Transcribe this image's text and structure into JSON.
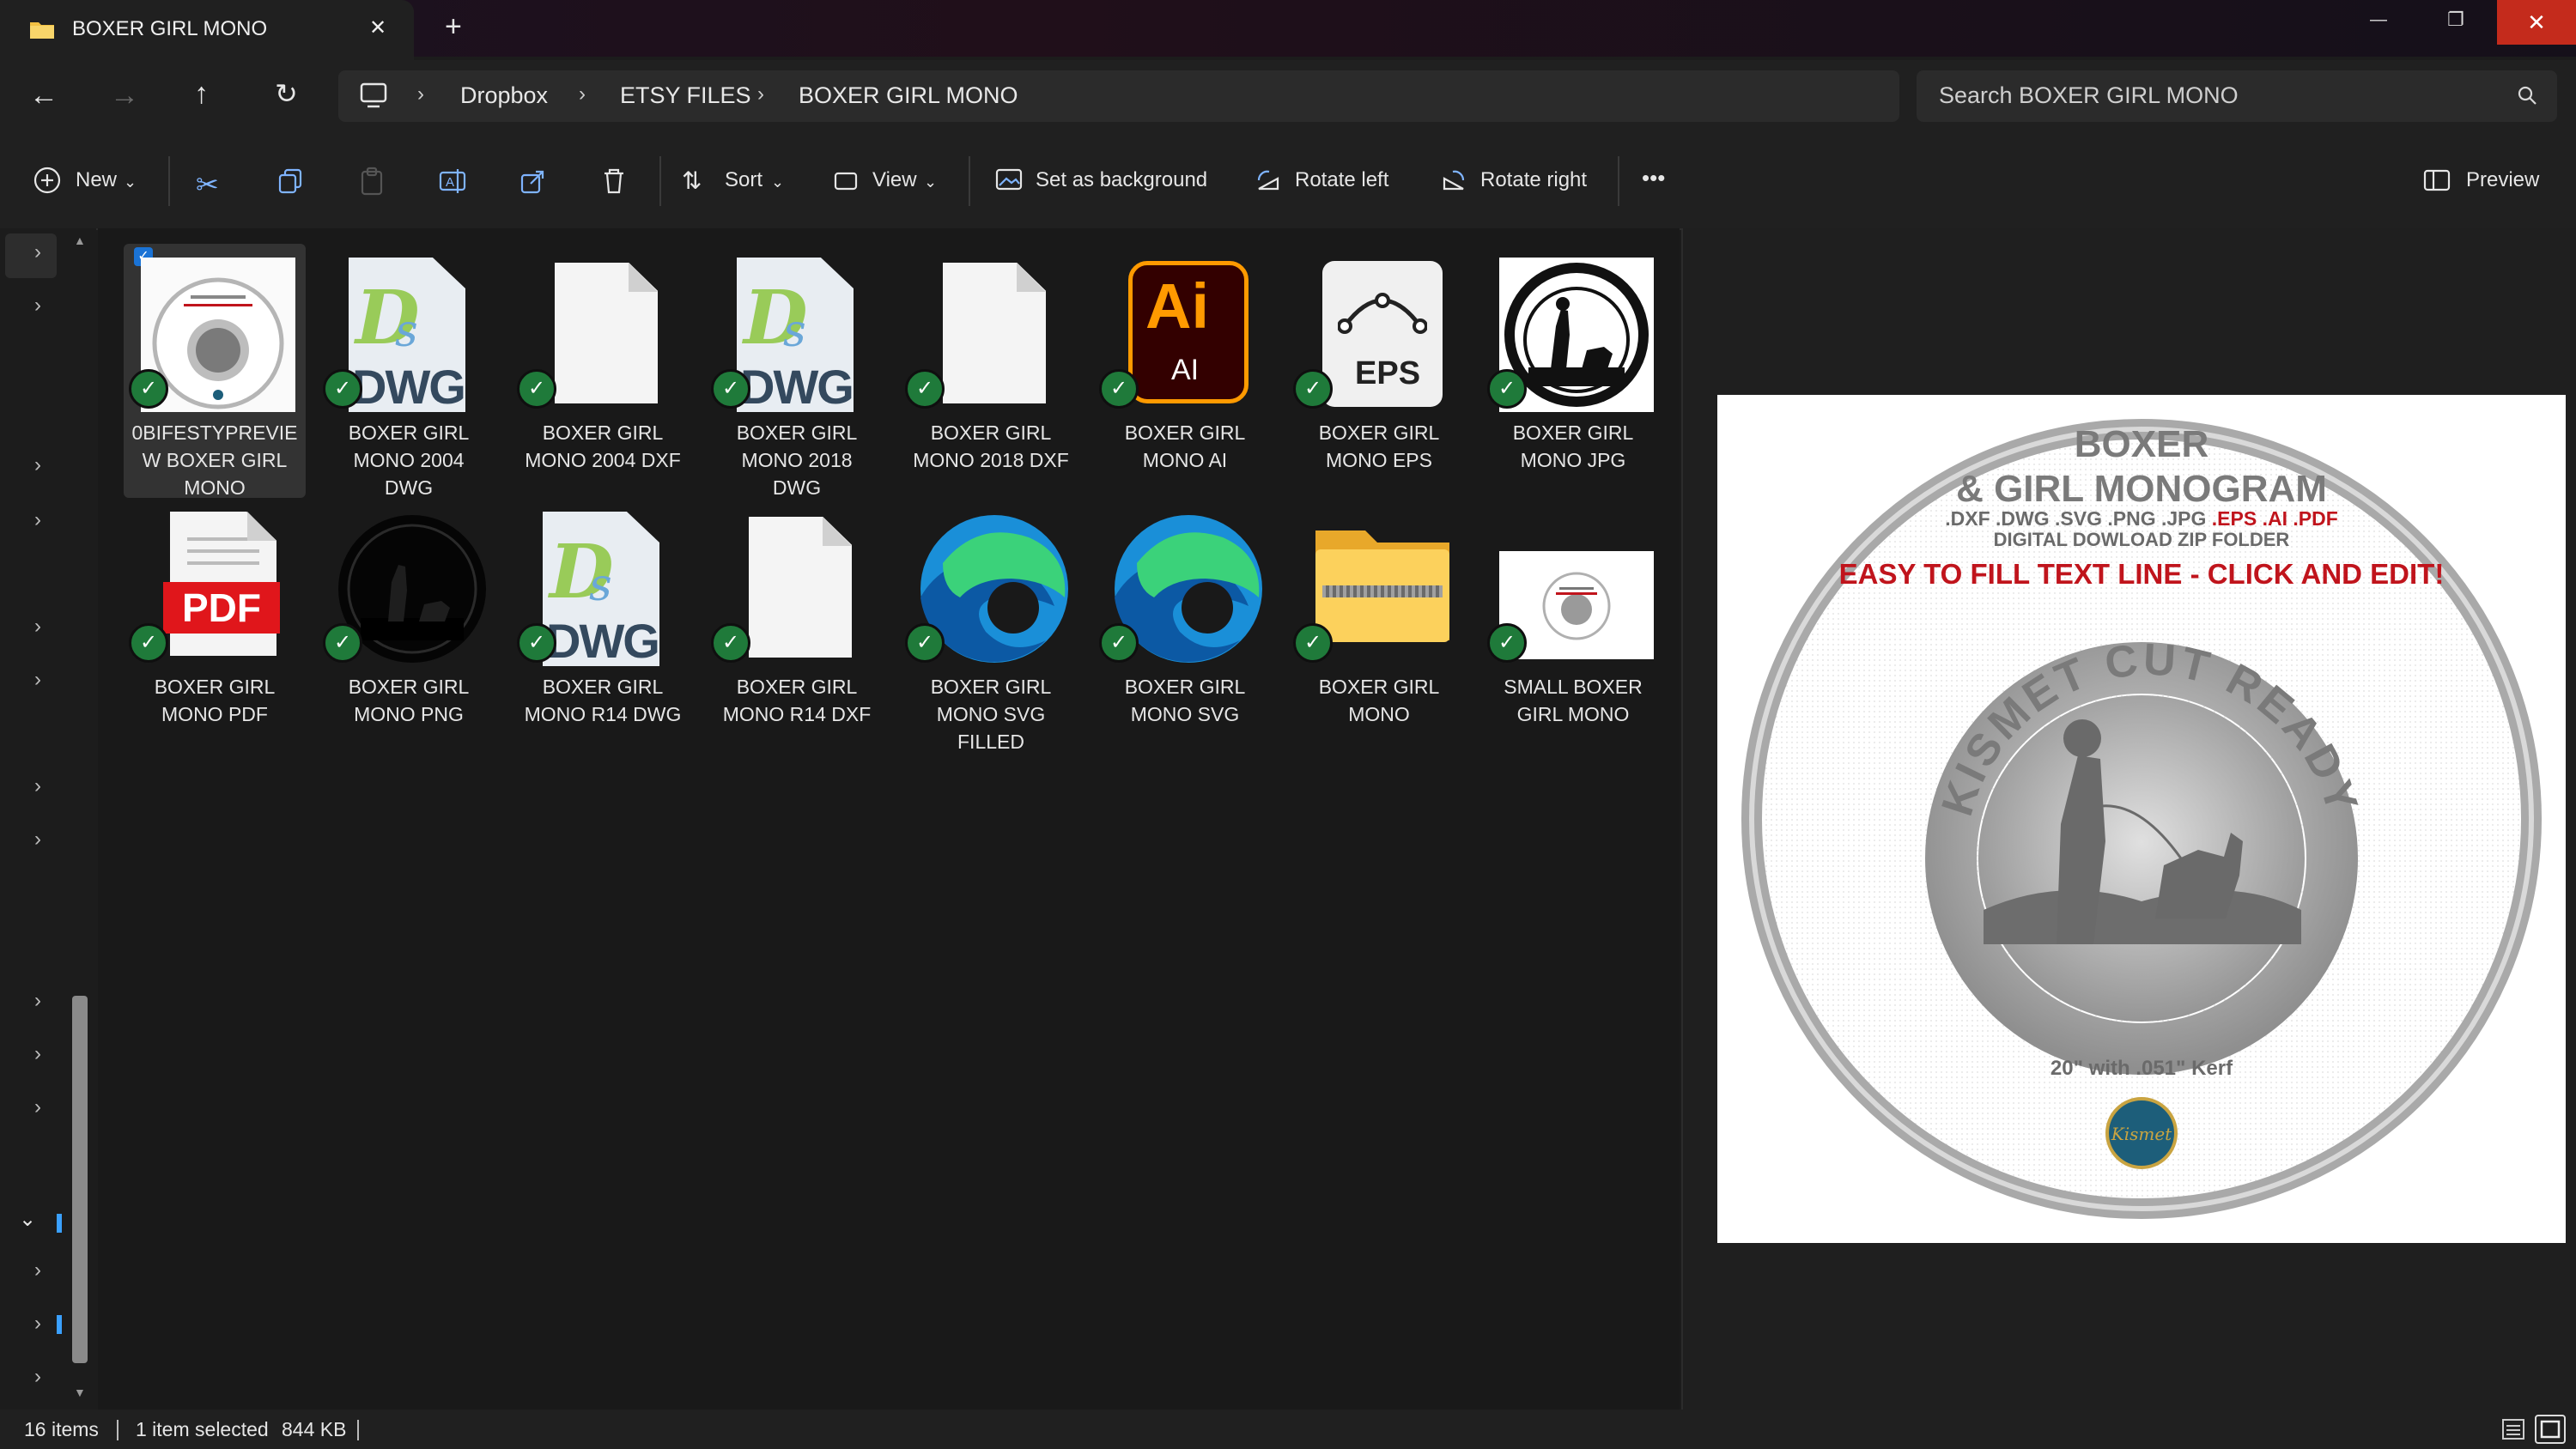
{
  "window": {
    "tab_title": "BOXER GIRL MONO",
    "tab_close": "✕",
    "new_tab": "+",
    "controls": {
      "minimize": "—",
      "restore": "❐",
      "close": "✕"
    }
  },
  "nav": {
    "breadcrumb": [
      "Dropbox",
      "ETSY FILES",
      "BOXER GIRL MONO"
    ],
    "search_placeholder": "Search BOXER GIRL MONO"
  },
  "toolbar": {
    "new_label": "New",
    "sort_label": "Sort",
    "view_label": "View",
    "set_background_label": "Set as background",
    "rotate_left_label": "Rotate left",
    "rotate_right_label": "Rotate right",
    "more_label": "•••",
    "preview_label": "Preview"
  },
  "files": [
    {
      "name": "0BIFESTYPREVIEW BOXER GIRL MONO",
      "lines": [
        "0BIFESTYPREVIE",
        "W BOXER GIRL",
        "MONO"
      ],
      "icon": "preview-thumbnail",
      "selected": true
    },
    {
      "name": "BOXER GIRL MONO 2004 DWG",
      "lines": [
        "BOXER GIRL",
        "MONO 2004",
        "DWG"
      ],
      "icon": "dwg-icon"
    },
    {
      "name": "BOXER GIRL MONO 2004 DXF",
      "lines": [
        "BOXER GIRL",
        "MONO 2004 DXF"
      ],
      "icon": "blank-file-icon"
    },
    {
      "name": "BOXER GIRL MONO 2018 DWG",
      "lines": [
        "BOXER GIRL",
        "MONO 2018",
        "DWG"
      ],
      "icon": "dwg-icon"
    },
    {
      "name": "BOXER GIRL MONO 2018 DXF",
      "lines": [
        "BOXER GIRL",
        "MONO 2018 DXF"
      ],
      "icon": "blank-file-icon"
    },
    {
      "name": "BOXER GIRL MONO AI",
      "lines": [
        "BOXER GIRL",
        "MONO AI"
      ],
      "icon": "illustrator-icon"
    },
    {
      "name": "BOXER GIRL MONO EPS",
      "lines": [
        "BOXER GIRL",
        "MONO EPS"
      ],
      "icon": "eps-icon"
    },
    {
      "name": "BOXER GIRL MONO JPG",
      "lines": [
        "BOXER GIRL",
        "MONO JPG"
      ],
      "icon": "monogram-jpg-thumbnail"
    },
    {
      "name": "BOXER GIRL MONO PDF",
      "lines": [
        "BOXER GIRL",
        "MONO PDF"
      ],
      "icon": "pdf-icon"
    },
    {
      "name": "BOXER GIRL MONO PNG",
      "lines": [
        "BOXER GIRL",
        "MONO PNG"
      ],
      "icon": "monogram-png-thumbnail"
    },
    {
      "name": "BOXER GIRL MONO R14 DWG",
      "lines": [
        "BOXER GIRL",
        "MONO R14 DWG"
      ],
      "icon": "dwg-icon"
    },
    {
      "name": "BOXER GIRL MONO R14 DXF",
      "lines": [
        "BOXER GIRL",
        "MONO R14 DXF"
      ],
      "icon": "blank-file-icon"
    },
    {
      "name": "BOXER GIRL MONO SVG FILLED",
      "lines": [
        "BOXER GIRL",
        "MONO SVG",
        "FILLED"
      ],
      "icon": "edge-icon"
    },
    {
      "name": "BOXER GIRL MONO SVG",
      "lines": [
        "BOXER GIRL",
        "MONO SVG"
      ],
      "icon": "edge-icon"
    },
    {
      "name": "BOXER GIRL MONO",
      "lines": [
        "BOXER GIRL",
        "MONO"
      ],
      "icon": "zip-folder-icon"
    },
    {
      "name": "SMALL BOXER GIRL MONO",
      "lines": [
        "SMALL BOXER",
        "GIRL MONO"
      ],
      "icon": "small-thumbnail"
    }
  ],
  "icon_text": {
    "dwg": "DWG",
    "ai_big": "Ai",
    "ai_small": "AI",
    "eps": "EPS",
    "pdf": "PDF",
    "check": "✓"
  },
  "preview_image": {
    "title1": "BOXER",
    "title2": "& GIRL MONOGRAM",
    "formats_a": ".DXF .DWG .SVG .PNG .JPG",
    "formats_b": " .EPS .AI .PDF",
    "subtitle": "DIGITAL DOWLOAD ZIP FOLDER",
    "tagline": "EASY TO FILL TEXT LINE - CLICK AND EDIT!",
    "ring_text": "KISMET CUT READY",
    "size_text": "20\" with .051\" Kerf",
    "logo_text": "Kismet"
  },
  "status": {
    "items": "16 items",
    "selection": "1 item selected",
    "size": "844 KB"
  },
  "colors": {
    "accent": "#0a63b8",
    "check": "#1f7a3a",
    "tagline_red": "#c0141c",
    "close_red": "#c42b1c"
  }
}
